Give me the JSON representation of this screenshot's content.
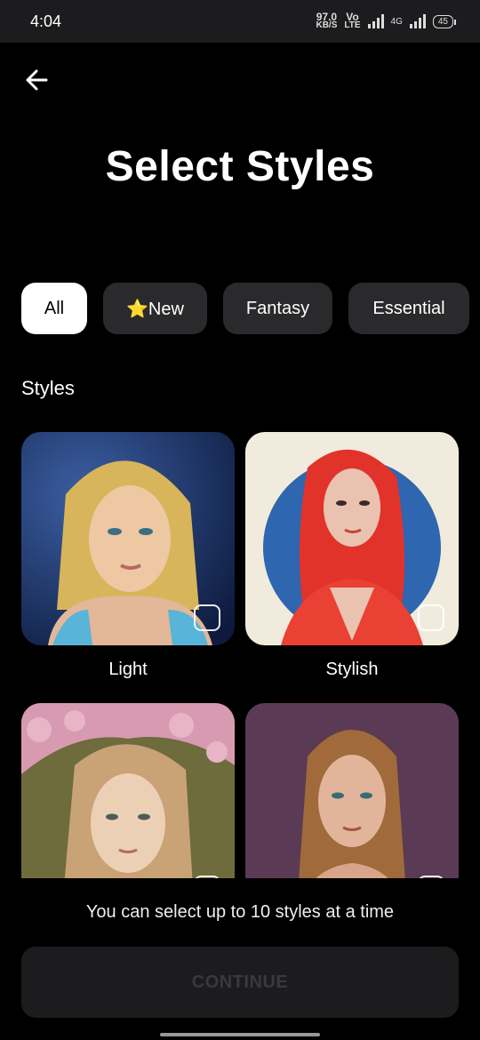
{
  "status": {
    "time": "4:04",
    "speed_value": "97.0",
    "speed_unit": "KB/S",
    "volte": "Vo",
    "volte_sub": "LTE",
    "network": "4G",
    "battery": "45"
  },
  "header": {
    "back_icon": "arrow-left-icon",
    "title": "Select Styles"
  },
  "filters": [
    {
      "label": "All",
      "active": true
    },
    {
      "label": "⭐New",
      "active": false
    },
    {
      "label": "Fantasy",
      "active": false
    },
    {
      "label": "Essential",
      "active": false
    }
  ],
  "section": {
    "title": "Styles"
  },
  "styles": [
    {
      "label": "Light"
    },
    {
      "label": "Stylish"
    },
    {
      "label": ""
    },
    {
      "label": ""
    }
  ],
  "helper_text": "You can select up to 10 styles at a time",
  "continue_label": "CONTINUE"
}
